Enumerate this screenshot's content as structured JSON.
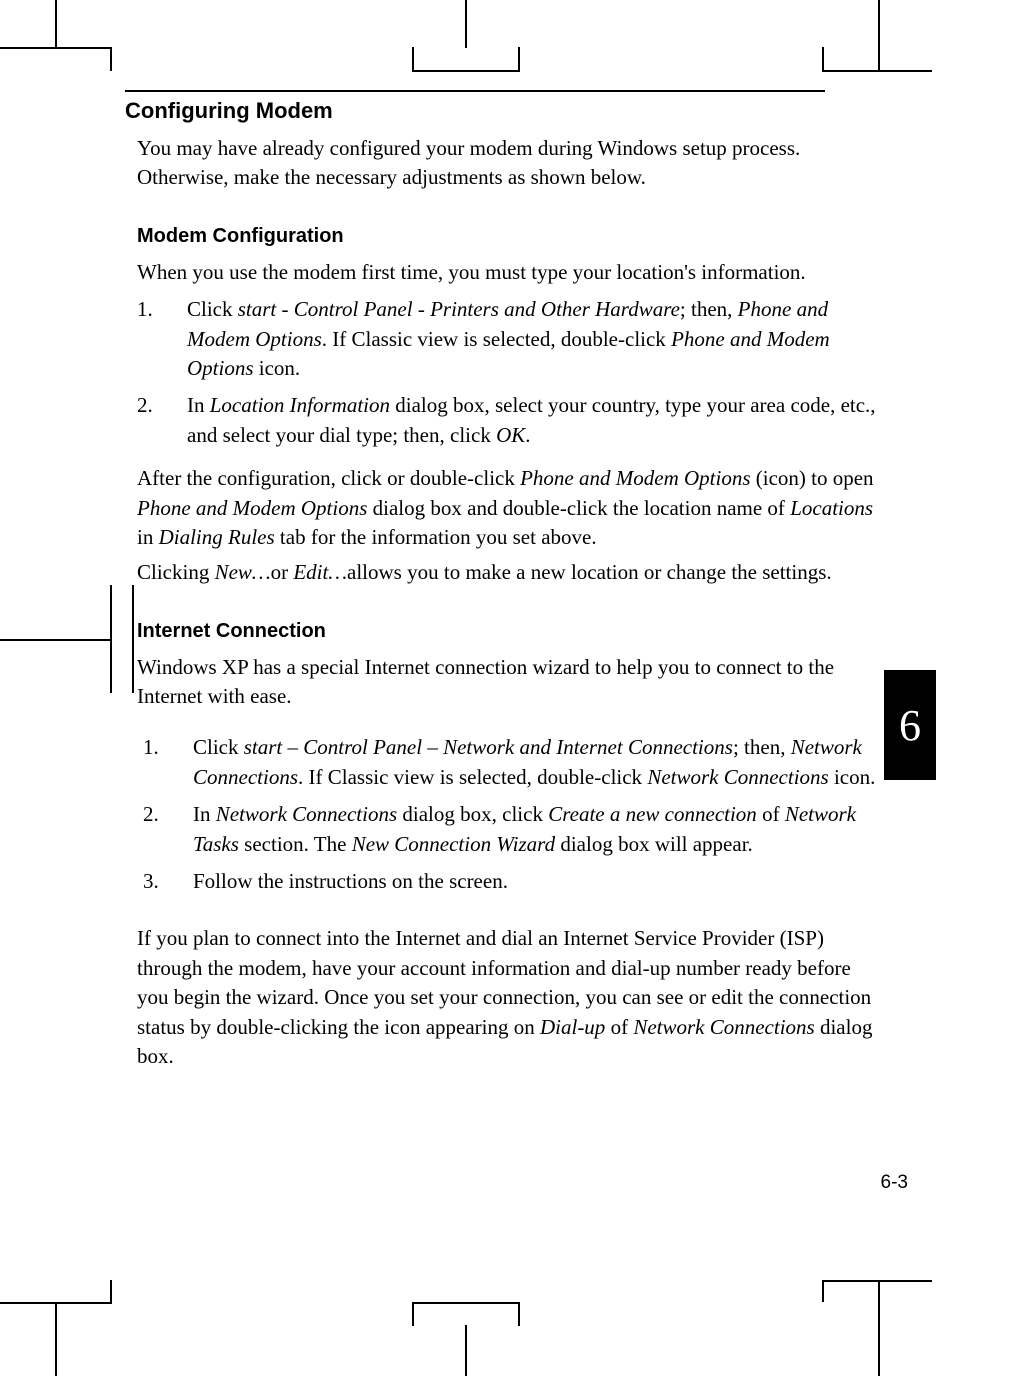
{
  "heading1": "Configuring Modem",
  "intro": "You may have already configured your modem during Windows setup process. Otherwise, make the necessary adjustments as shown below.",
  "section1": {
    "heading": "Modem Configuration",
    "intro": "When you use the modem first time, you must type your location's information.",
    "li1_prefix": "Click ",
    "li1_i1": "start - Control Panel",
    "li1_mid1": " - ",
    "li1_i2": "Printers and Other Hardware",
    "li1_mid2": "; then, ",
    "li1_i3": "Phone and Modem Options",
    "li1_mid3": ". If Classic view is selected, double-click ",
    "li1_i4": "Phone and Modem Options",
    "li1_suffix": " icon.",
    "li2_prefix": "In ",
    "li2_i1": "Location Information",
    "li2_mid1": " dialog box, select your country, type your area code, etc., and select your dial type; then, click ",
    "li2_i2": "OK",
    "li2_suffix": ".",
    "p2_prefix": "After the configuration, click or double-click ",
    "p2_i1": "Phone and Modem Options",
    "p2_mid1": " (icon) to open ",
    "p2_i2": "Phone and Modem Options",
    "p2_mid2": " dialog box and double-click the location name of ",
    "p2_i3": "Locations",
    "p2_mid3": " in ",
    "p2_i4": "Dialing Rules",
    "p2_suffix": " tab for the information you set above.",
    "p3_prefix": "Clicking ",
    "p3_i1": "New…",
    "p3_mid1": "or ",
    "p3_i2": "Edit…",
    "p3_suffix": "allows you to make a new location or change the settings."
  },
  "section2": {
    "heading": "Internet Connection",
    "intro": "Windows XP has a special Internet connection wizard to help you to connect to the Internet with ease.",
    "li1_prefix": "Click ",
    "li1_i1": "start – Control Panel – Network and Internet Connections",
    "li1_mid1": "; then, ",
    "li1_i2": "Network Connections",
    "li1_mid2": ". If Classic view is selected, double-click ",
    "li1_i3": "Network Connections",
    "li1_suffix": " icon.",
    "li2_prefix": "In ",
    "li2_i1": "Network Connections",
    "li2_mid1": " dialog box, click ",
    "li2_i2": "Create a new connection",
    "li2_mid2": " of ",
    "li2_i3": "Network Tasks",
    "li2_mid3": " section. The ",
    "li2_i4": "New Connection Wizard",
    "li2_suffix": " dialog box will appear.",
    "li3": "Follow the instructions on the screen.",
    "p2_prefix": "If you plan to connect into the Internet and dial an Internet Service Provider (ISP) through the modem, have your account information and dial-up number ready before you begin the wizard. Once you set your connection, you can see or edit the connection status by double-clicking the icon appearing on ",
    "p2_i1": "Dial-up",
    "p2_mid1": " of ",
    "p2_i2": "Network Connections",
    "p2_suffix": " dialog box."
  },
  "chapter": "6",
  "pageNumber": "6-3"
}
